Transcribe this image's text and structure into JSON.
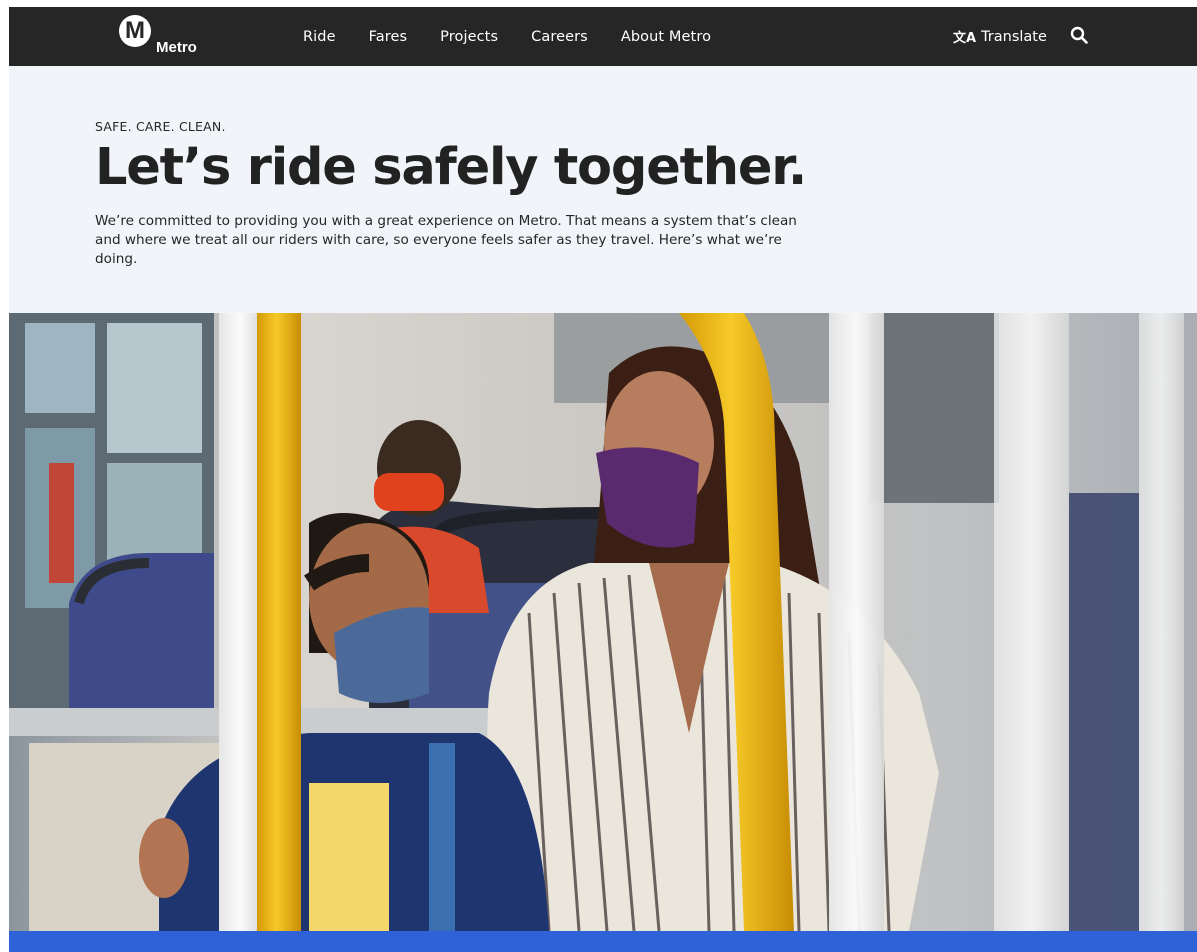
{
  "header": {
    "logo_letter": "M",
    "logo_text": "Metro",
    "nav": [
      {
        "label": "Ride"
      },
      {
        "label": "Fares"
      },
      {
        "label": "Projects"
      },
      {
        "label": "Careers"
      },
      {
        "label": "About Metro"
      }
    ],
    "translate_label": "Translate",
    "translate_icon": "translate-icon",
    "search_icon": "search-icon"
  },
  "hero": {
    "eyebrow": "SAFE. CARE. CLEAN.",
    "headline": "Let’s ride safely together.",
    "intro": "We’re committed to providing you with a great experience on Metro. That means a system that’s clean and where we treat all our riders with care, so everyone feels safer as they travel. Here’s what we’re doing."
  },
  "colors": {
    "nav_bg": "#262626",
    "hero_bg": "#f1f4f8",
    "accent_blue": "#2f62d9",
    "pole_yellow": "#f2c41a"
  }
}
